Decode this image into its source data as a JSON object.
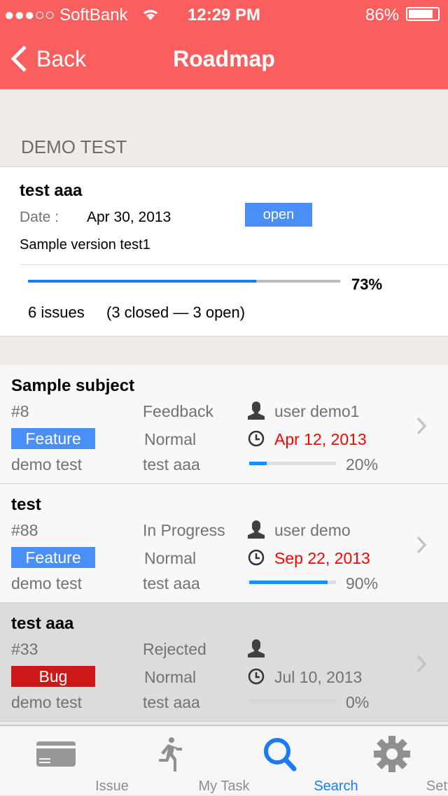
{
  "status": {
    "carrier": "●●●○○ SoftBank",
    "time": "12:29 PM",
    "battery": "86%",
    "battery_level": 0.86
  },
  "nav": {
    "back": "Back",
    "title": "Roadmap"
  },
  "section": "DEMO TEST",
  "version": {
    "name": "test aaa",
    "date_label": "Date :",
    "date": "Apr 30, 2013",
    "status": "open",
    "description": "Sample version test1",
    "progress": 73,
    "progress_label": "73%",
    "issues": "6 issues",
    "breakdown": "(3 closed — 3 open)"
  },
  "issues": [
    {
      "subject": "Sample subject",
      "id": "#8",
      "status": "Feedback",
      "assignee": "user demo1",
      "tracker": "Feature",
      "tracker_color": "#4a8ff7",
      "priority": "Normal",
      "due": "Apr 12, 2013",
      "due_color": "#ff0000",
      "project": "demo test",
      "version": "test aaa",
      "progress": 20,
      "progress_label": "20%"
    },
    {
      "subject": "test",
      "id": "#88",
      "status": "In Progress",
      "assignee": "user demo",
      "tracker": "Feature",
      "tracker_color": "#4a8ff7",
      "priority": "Normal",
      "due": "Sep 22, 2013",
      "due_color": "#ff0000",
      "project": "demo test",
      "version": "test aaa",
      "progress": 90,
      "progress_label": "90%"
    },
    {
      "subject": "test aaa",
      "id": "#33",
      "status": "Rejected",
      "assignee": "",
      "tracker": "Bug",
      "tracker_color": "#cc1818",
      "priority": "Normal",
      "due": "Jul 10, 2013",
      "due_color": "#727272",
      "project": "demo test",
      "version": "test aaa",
      "progress": 0,
      "progress_label": "0%"
    }
  ],
  "tabs": [
    {
      "label": "Issue",
      "icon": "card-icon"
    },
    {
      "label": "My Task",
      "icon": "running-man-icon"
    },
    {
      "label": "Search",
      "icon": "search-icon",
      "active": true
    },
    {
      "label": "Setting",
      "icon": "gear-icon"
    }
  ],
  "colors": {
    "nav": "#fb5e5e",
    "accent": "#1a7cf5"
  }
}
